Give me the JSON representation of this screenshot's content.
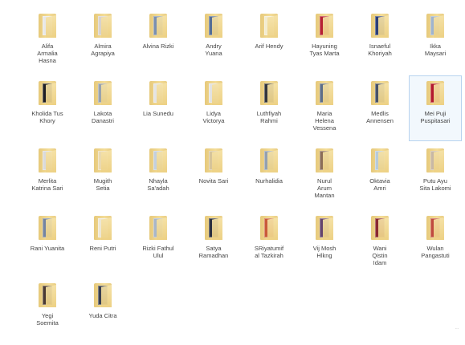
{
  "folders": [
    {
      "label": "Alifa\nArmalia\nHasna",
      "color": "#e8e8e8"
    },
    {
      "label": "Almira\nAgrapiya",
      "color": "#d8d2cc"
    },
    {
      "label": "Alvina Rizki",
      "color": "#7a8fb0"
    },
    {
      "label": "Andry\nYuana",
      "color": "#556e96"
    },
    {
      "label": "Arif Hendy",
      "color": "#f3ecd0"
    },
    {
      "label": "Hayuning\nTyas Marta",
      "color": "#b62233"
    },
    {
      "label": "Isnaeful\nKhoriyah",
      "color": "#2c3f78"
    },
    {
      "label": "Ikka\nMaysari",
      "color": "#9fb4ce"
    },
    {
      "label": "Kholida Tus\nKhory",
      "color": "#1e1e24"
    },
    {
      "label": "Lakota\nDanastri",
      "color": "#9aa3ad"
    },
    {
      "label": "Lia Sunedu",
      "color": "#e4e4e4"
    },
    {
      "label": "Lidya\nVictorya",
      "color": "#e2e2e2"
    },
    {
      "label": "Luthfiyah\nRahmi",
      "color": "#34363d"
    },
    {
      "label": "Maria\nHelena\nVessena",
      "color": "#5f6f88"
    },
    {
      "label": "Medlis\nAnnensen",
      "color": "#485268"
    },
    {
      "label": "Mei Puji\nPuspitasari",
      "color": "#b3182e"
    },
    {
      "label": "Merlita\nKatrina Sari",
      "color": "#dadada"
    },
    {
      "label": "Mugith\nSetia",
      "color": "#ead9ae"
    },
    {
      "label": "Nhayla\nSa'adah",
      "color": "#c3d0de"
    },
    {
      "label": "Novita Sari",
      "color": "#d6c49a"
    },
    {
      "label": "Nurhalidia",
      "color": "#93a0b0"
    },
    {
      "label": "Nurul\nArum\nMantan",
      "color": "#8c6e58"
    },
    {
      "label": "Oktavia\nAmri",
      "color": "#b7cad9"
    },
    {
      "label": "Putu Ayu\nSita Lakomi",
      "color": "#c8b8a4"
    },
    {
      "label": "Rani Yuanita",
      "color": "#7484a0"
    },
    {
      "label": "Reni Putri",
      "color": "#ede7d4"
    },
    {
      "label": "Rizki Fathul\nUlul",
      "color": "#a8b6c8"
    },
    {
      "label": "Satya\nRamadhan",
      "color": "#2b3040"
    },
    {
      "label": "SRiyatumif\nal Tazkirah",
      "color": "#c95a3a"
    },
    {
      "label": "Vij Mosh\nHlkng",
      "color": "#66456d"
    },
    {
      "label": "Wani\nQistin\nIdam",
      "color": "#8a2930"
    },
    {
      "label": "Wulan\nPangastuti",
      "color": "#c04a3e"
    },
    {
      "label": "Yegi\nSoemita",
      "color": "#4a3a33"
    },
    {
      "label": "Yuda Citra",
      "color": "#3a3f4e"
    }
  ],
  "selected_index": 15,
  "status_text": "  ..."
}
